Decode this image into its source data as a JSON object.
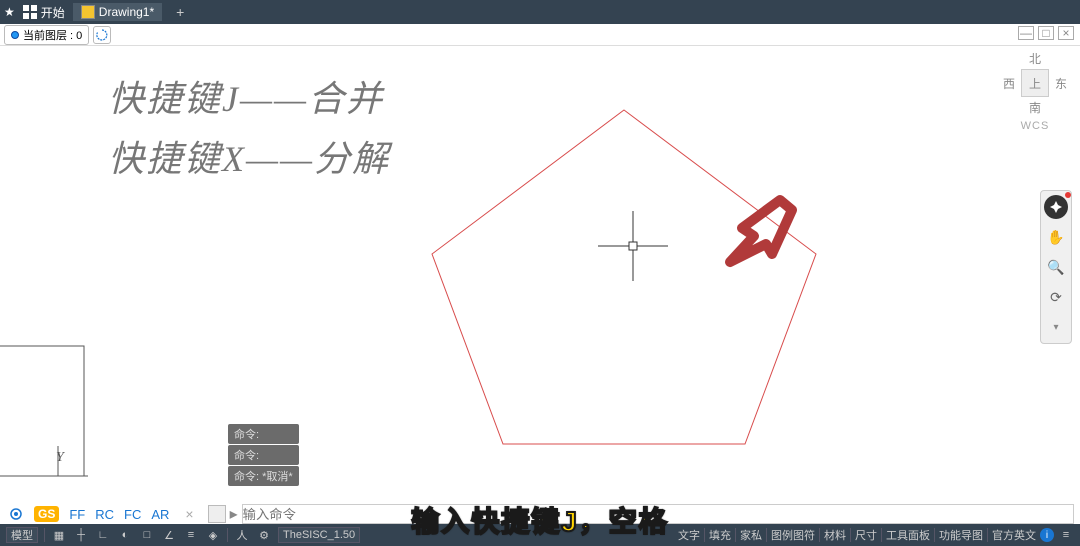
{
  "titlebar": {
    "start": "开始",
    "tab": "Drawing1*",
    "plus": "+"
  },
  "layerbar": {
    "label": "当前图层 : 0"
  },
  "annot": {
    "line1": "快捷键J——合并",
    "line2": "快捷键X——分解"
  },
  "axis": {
    "y": "Y"
  },
  "viewcube": {
    "n": "北",
    "w": "西",
    "top": "上",
    "e": "东",
    "s": "南",
    "wcs": "WCS"
  },
  "cmd": {
    "hist1": "命令:",
    "hist2": "命令:",
    "hist3": "命令: *取消*",
    "prompt": "输入命令",
    "tabs": [
      "FF",
      "RC",
      "FC",
      "AR"
    ]
  },
  "gs_badge": "GS",
  "statusbar": {
    "model": "模型",
    "font": "TheSISC_1.50",
    "right_items": [
      "文字",
      "填充",
      "家私",
      "图例图符",
      "材料",
      "尺寸",
      "工具面板",
      "功能导图",
      "官方英文"
    ]
  },
  "caption": "输入快捷键J，空格",
  "colors": {
    "pentagon": "#d84c4c",
    "arrow": "#b13a3a"
  }
}
